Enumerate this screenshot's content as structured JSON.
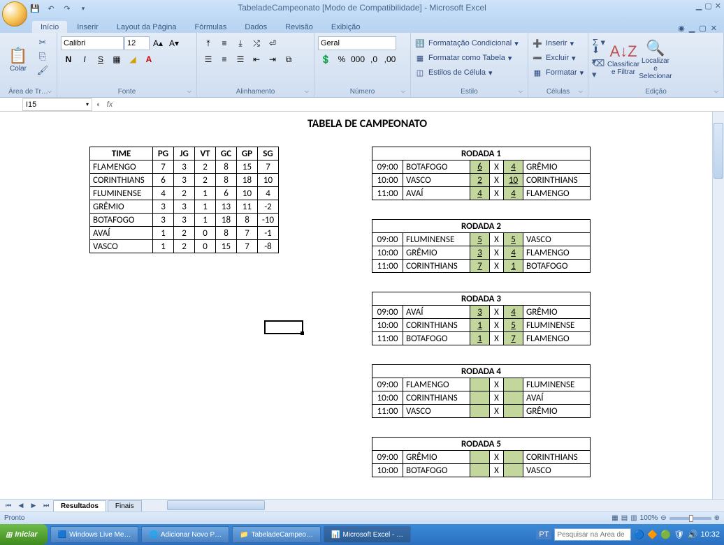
{
  "title": "TabeladeCampeonato  [Modo de Compatibilidade] - Microsoft Excel",
  "tabs": {
    "inicio": "Início",
    "inserir": "Inserir",
    "layout": "Layout da Página",
    "formulas": "Fórmulas",
    "dados": "Dados",
    "revisao": "Revisão",
    "exibicao": "Exibição"
  },
  "clipboard": {
    "paste": "Colar",
    "group": "Área de Tr…"
  },
  "font": {
    "name": "Calibri",
    "size": "12",
    "group": "Fonte"
  },
  "align": {
    "group": "Alinhamento"
  },
  "number": {
    "format": "Geral",
    "group": "Número"
  },
  "styles": {
    "cond": "Formatação Condicional",
    "table": "Formatar como Tabela",
    "cell": "Estilos de Célula",
    "group": "Estilo"
  },
  "cells": {
    "insert": "Inserir",
    "delete": "Excluir",
    "format": "Formatar",
    "group": "Células"
  },
  "editing": {
    "sort": "Classificar e Filtrar",
    "find": "Localizar e Selecionar",
    "group": "Edição"
  },
  "namebox": "I15",
  "sheet_title": "TABELA DE CAMPEONATO",
  "standings": {
    "headers": [
      "TIME",
      "PG",
      "JG",
      "VT",
      "GC",
      "GP",
      "SG"
    ],
    "rows": [
      [
        "FLAMENGO",
        "7",
        "3",
        "2",
        "8",
        "15",
        "7"
      ],
      [
        "CORINTHIANS",
        "6",
        "3",
        "2",
        "8",
        "18",
        "10"
      ],
      [
        "FLUMINENSE",
        "4",
        "2",
        "1",
        "6",
        "10",
        "4"
      ],
      [
        "GRÊMIO",
        "3",
        "3",
        "1",
        "13",
        "11",
        "-2"
      ],
      [
        "BOTAFOGO",
        "3",
        "3",
        "1",
        "18",
        "8",
        "-10"
      ],
      [
        "AVAÍ",
        "1",
        "2",
        "0",
        "8",
        "7",
        "-1"
      ],
      [
        "VASCO",
        "1",
        "2",
        "0",
        "15",
        "7",
        "-8"
      ]
    ]
  },
  "rounds": [
    {
      "title": "RODADA 1",
      "games": [
        [
          "09:00",
          "BOTAFOGO",
          "6",
          "X",
          "4",
          "GRÊMIO"
        ],
        [
          "10:00",
          "VASCO",
          "2",
          "X",
          "10",
          "CORINTHIANS"
        ],
        [
          "11:00",
          "AVAÍ",
          "4",
          "X",
          "4",
          "FLAMENGO"
        ]
      ]
    },
    {
      "title": "RODADA 2",
      "games": [
        [
          "09:00",
          "FLUMINENSE",
          "5",
          "X",
          "5",
          "VASCO"
        ],
        [
          "10:00",
          "GRÊMIO",
          "3",
          "X",
          "4",
          "FLAMENGO"
        ],
        [
          "11:00",
          "CORINTHIANS",
          "7",
          "X",
          "1",
          "BOTAFOGO"
        ]
      ]
    },
    {
      "title": "RODADA 3",
      "games": [
        [
          "09:00",
          "AVAÍ",
          "3",
          "X",
          "4",
          "GRÊMIO"
        ],
        [
          "10:00",
          "CORINTHIANS",
          "1",
          "X",
          "5",
          "FLUMINENSE"
        ],
        [
          "11:00",
          "BOTAFOGO",
          "1",
          "X",
          "7",
          "FLAMENGO"
        ]
      ]
    },
    {
      "title": "RODADA 4",
      "games": [
        [
          "09:00",
          "FLAMENGO",
          "",
          "X",
          "",
          "FLUMINENSE"
        ],
        [
          "10:00",
          "CORINTHIANS",
          "",
          "X",
          "",
          "AVAÍ"
        ],
        [
          "11:00",
          "VASCO",
          "",
          "X",
          "",
          "GRÊMIO"
        ]
      ]
    },
    {
      "title": "RODADA 5",
      "games": [
        [
          "09:00",
          "GRÊMIO",
          "",
          "X",
          "",
          "CORINTHIANS"
        ],
        [
          "10:00",
          "BOTAFOGO",
          "",
          "X",
          "",
          "VASCO"
        ]
      ]
    }
  ],
  "sheet_tabs": {
    "t1": "Resultados",
    "t2": "Finais"
  },
  "status": "Pronto",
  "zoom": "100%",
  "start": "Iniciar",
  "tasks": {
    "t1": "Windows Live Me…",
    "t2": "Adicionar Novo P…",
    "t3": "TabeladeCampeo…",
    "t4": "Microsoft Excel - …"
  },
  "lang": "PT",
  "search_ph": "Pesquisar na Área de",
  "clock": "10:32"
}
